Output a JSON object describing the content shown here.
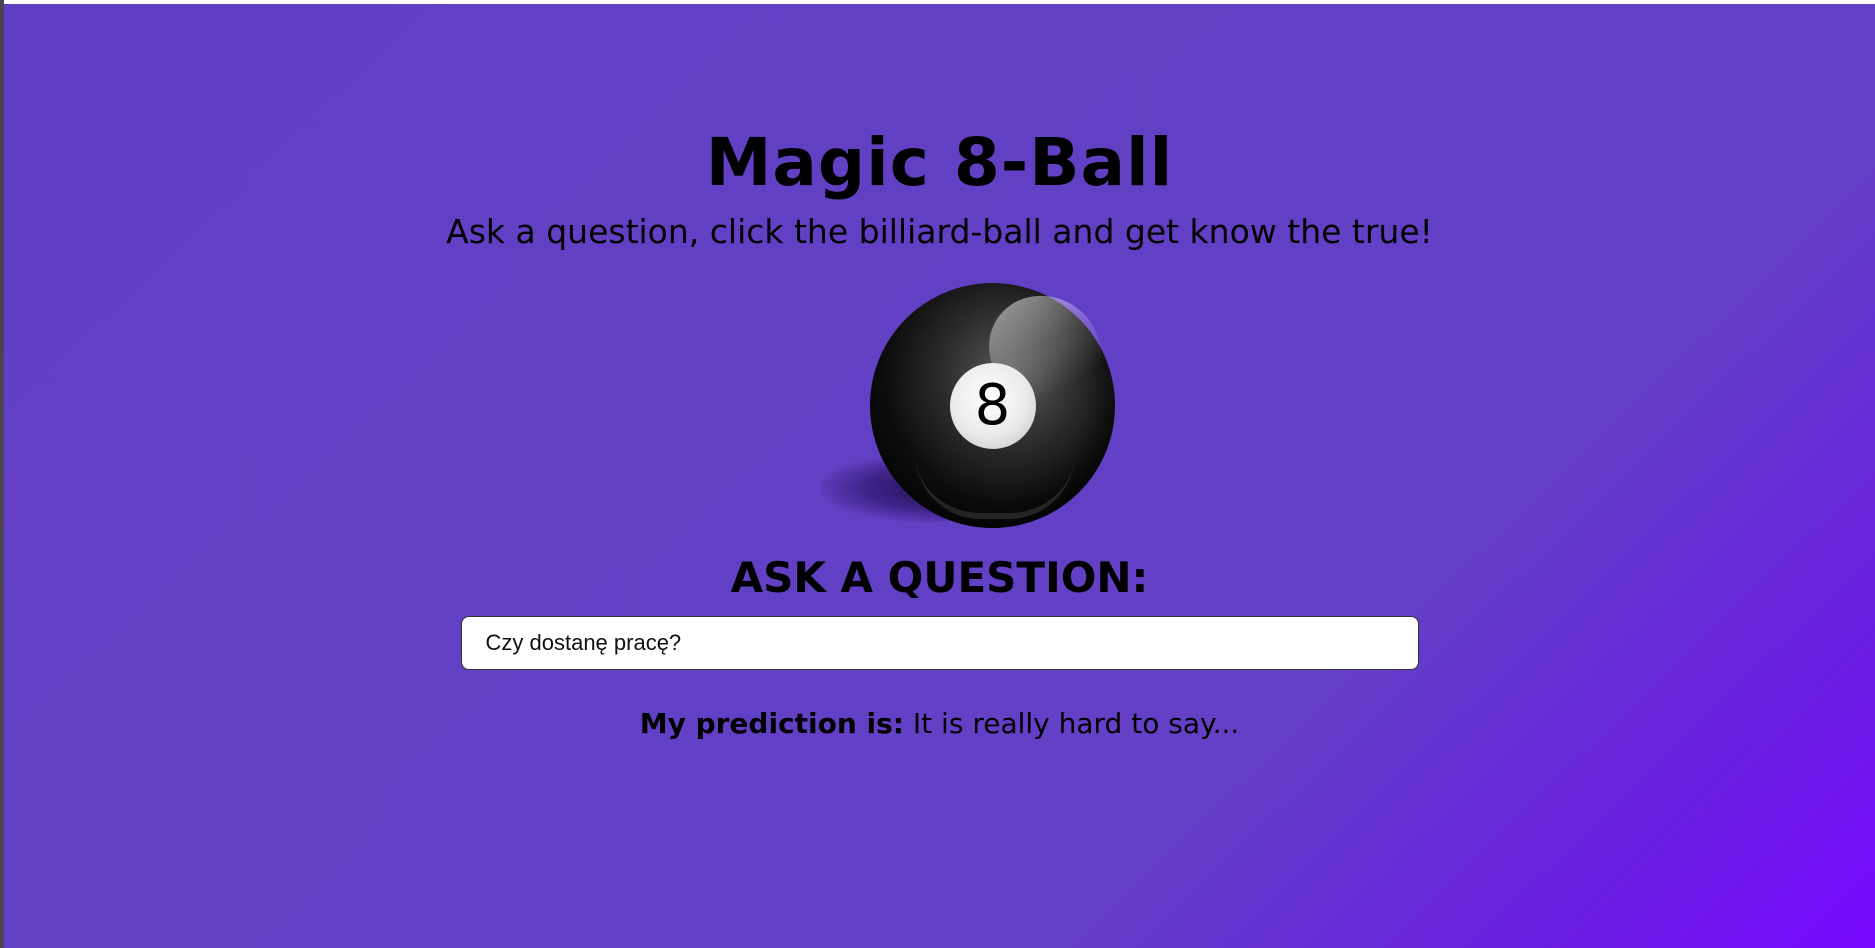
{
  "page": {
    "title": "Magic 8-Ball",
    "subtitle": "Ask a question, click the billiard-ball and get know the true!"
  },
  "ball": {
    "number": "8",
    "icon": "billiard-8-ball"
  },
  "question": {
    "label": "ASK A QUESTION:",
    "value": "Czy dostanę pracę?"
  },
  "prediction": {
    "label": "My prediction is:",
    "text": "It is really hard to say..."
  },
  "colors": {
    "background_start": "#613fc4",
    "background_end": "#7707ff",
    "text": "#000000",
    "input_bg": "#ffffff"
  }
}
